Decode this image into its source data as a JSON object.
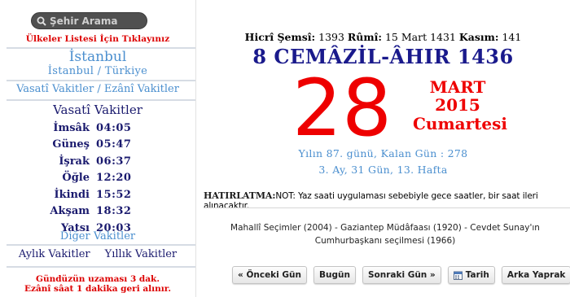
{
  "sidebar": {
    "search": {
      "placeholder": "Şehir Arama",
      "value": ""
    },
    "country_link": "Ülkeler Listesi İçin Tıklayınız",
    "city": "İstanbul",
    "city_country": "İstanbul / Türkiye",
    "toggle": {
      "vasati": "Vasatî Vakitler",
      "separator": "/",
      "ezani": "Ezânî Vakitler"
    },
    "times_title": "Vasatî Vakitler",
    "times": [
      {
        "label": "İmsâk",
        "value": "04:05"
      },
      {
        "label": "Güneş",
        "value": "05:47"
      },
      {
        "label": "İşrak",
        "value": "06:37"
      },
      {
        "label": "Öğle",
        "value": "12:20"
      },
      {
        "label": "İkindi",
        "value": "15:52"
      },
      {
        "label": "Akşam",
        "value": "18:32"
      },
      {
        "label": "Yatsı",
        "value": "20:03"
      }
    ],
    "other_times": "Diğer Vakitler",
    "monthly": "Aylık Vakitler",
    "yearly": "Yıllık Vakitler",
    "note_line1": "Gündüzün uzaması 3 dak.",
    "note_line2": "Ezânî sâat 1 dakika geri alınır."
  },
  "main": {
    "hijri_shamsi_label": "Hicrî Şemsî:",
    "hijri_shamsi_value": "1393",
    "rumi_label": "Rûmî:",
    "rumi_value": "15 Mart 1431",
    "kasim_label": "Kasım:",
    "kasim_value": "141",
    "hijri_date": "8 CEMÂZİL-ÂHIR 1436",
    "day": "28",
    "month": "MART",
    "year": "2015",
    "weekday": "Cumartesi",
    "day_of_year": "Yılın 87. günü, Kalan Gün : 278",
    "week_info": "3. Ay, 31 Gün, 13. Hafta",
    "reminder_label": "HATIRLATMA:",
    "reminder_text": "NOT: Yaz saati uygulaması sebebiyle gece saatler, bir saat ileri alınacaktır.",
    "events": "Mahallî Seçimler (2004) - Gaziantep Müdâfaası (1920) - Cevdet Sunay'ın Cumhurbaşkanı seçilmesi (1966)",
    "buttons": {
      "prev": "« Önceki Gün",
      "today": "Bugün",
      "next": "Sonraki Gün »",
      "date": "Tarih",
      "back": "Arka Yaprak"
    }
  },
  "colors": {
    "red": "#ee0000",
    "navy": "#1a1a8c",
    "link_blue": "#4b8fcf"
  }
}
